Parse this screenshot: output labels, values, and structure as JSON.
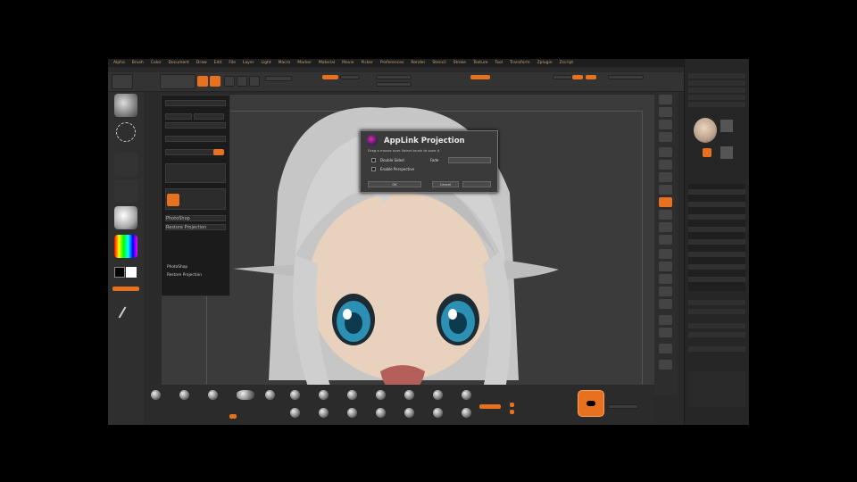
{
  "dialog": {
    "title": "AppLink Projection",
    "subtitle": "Drag a mouse over Select brush to save it",
    "option1": "Double Sided",
    "option2": "Fade",
    "option3": "Enable Perspective",
    "button_ok": "OK",
    "button_cancel": "Cancel"
  },
  "popup": {
    "item1": "PhotoShop",
    "item2": "Restore Projection",
    "footer1": "PhotoShop",
    "footer2": "Restore Projection"
  },
  "colors": {
    "accent": "#e8711f",
    "background": "#2a2a2a"
  },
  "icons": [
    "brush-icon",
    "color-picker-icon",
    "sphere-icon",
    "orange-gem-icon"
  ]
}
